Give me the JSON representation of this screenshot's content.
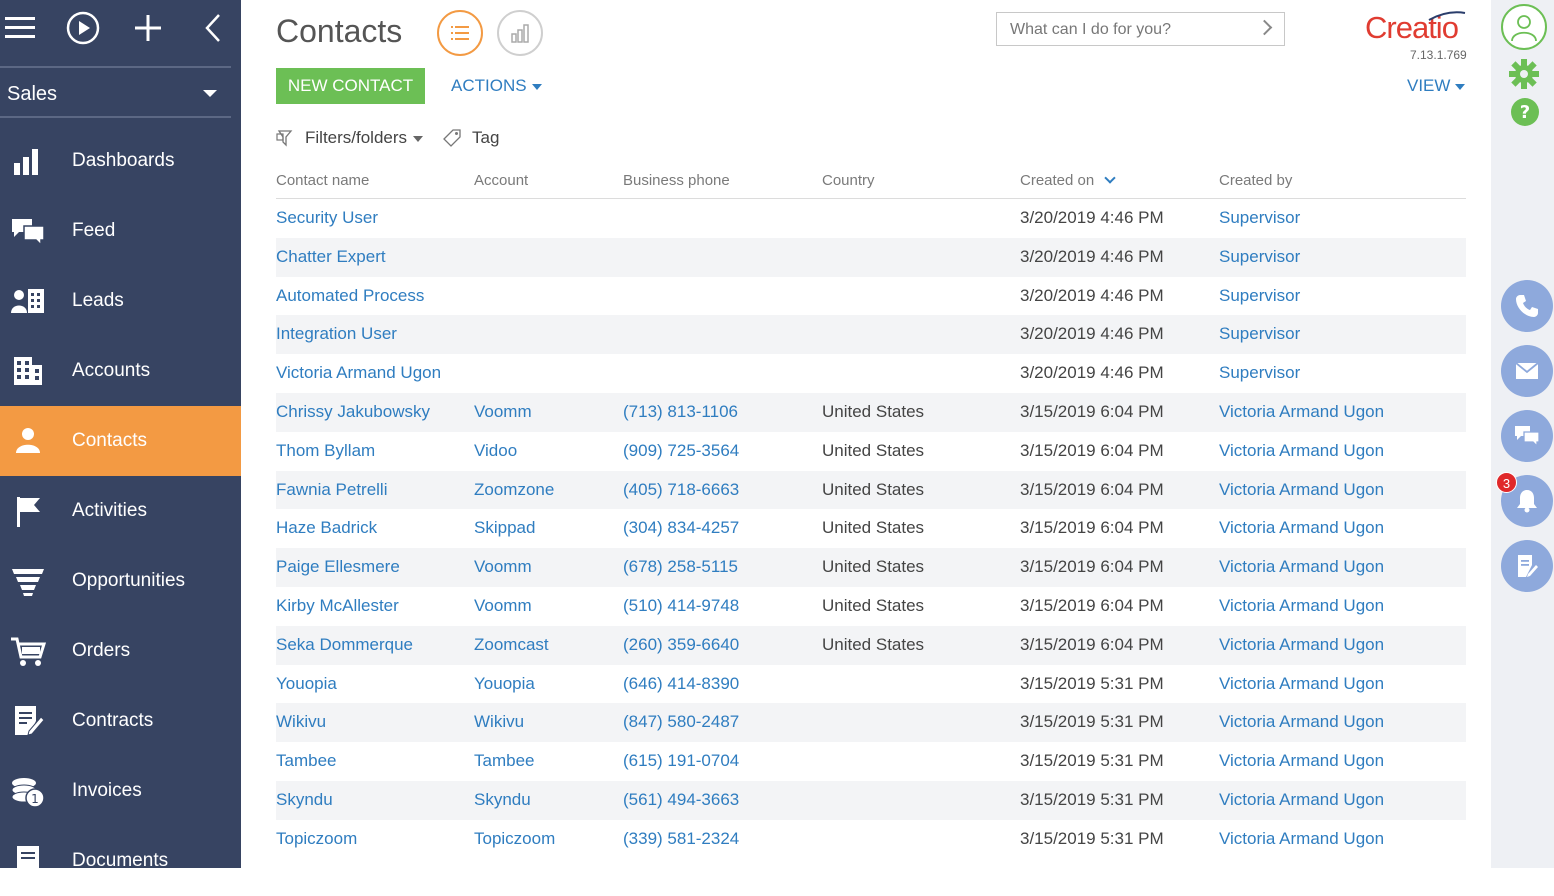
{
  "sidebar": {
    "workspace": "Sales",
    "items": [
      {
        "label": "Dashboards",
        "icon": "dashboards-icon"
      },
      {
        "label": "Feed",
        "icon": "feed-icon"
      },
      {
        "label": "Leads",
        "icon": "leads-icon"
      },
      {
        "label": "Accounts",
        "icon": "accounts-icon"
      },
      {
        "label": "Contacts",
        "icon": "contacts-icon",
        "active": true
      },
      {
        "label": "Activities",
        "icon": "activities-icon"
      },
      {
        "label": "Opportunities",
        "icon": "opportunities-icon"
      },
      {
        "label": "Orders",
        "icon": "orders-icon"
      },
      {
        "label": "Contracts",
        "icon": "contracts-icon"
      },
      {
        "label": "Invoices",
        "icon": "invoices-icon"
      },
      {
        "label": "Documents",
        "icon": "documents-icon"
      }
    ]
  },
  "header": {
    "title": "Contacts",
    "command_placeholder": "What can I do for you?",
    "logo": "Creatio",
    "version": "7.13.1.769",
    "new_contact": "NEW CONTACT",
    "actions": "ACTIONS",
    "view": "VIEW",
    "filters": "Filters/folders",
    "tag": "Tag"
  },
  "grid": {
    "columns": [
      "Contact name",
      "Account",
      "Business phone",
      "Country",
      "Created on",
      "Created by"
    ],
    "rows": [
      [
        "Security User",
        "",
        "",
        "",
        "3/20/2019 4:46 PM",
        "Supervisor"
      ],
      [
        "Chatter Expert",
        "",
        "",
        "",
        "3/20/2019 4:46 PM",
        "Supervisor"
      ],
      [
        "Automated Process",
        "",
        "",
        "",
        "3/20/2019 4:46 PM",
        "Supervisor"
      ],
      [
        "Integration User",
        "",
        "",
        "",
        "3/20/2019 4:46 PM",
        "Supervisor"
      ],
      [
        "Victoria Armand Ugon",
        "",
        "",
        "",
        "3/20/2019 4:46 PM",
        "Supervisor"
      ],
      [
        "Chrissy Jakubowsky",
        "Voomm",
        "(713) 813-1106",
        "United States",
        "3/15/2019 6:04 PM",
        "Victoria Armand Ugon"
      ],
      [
        "Thom Byllam",
        "Vidoo",
        "(909) 725-3564",
        "United States",
        "3/15/2019 6:04 PM",
        "Victoria Armand Ugon"
      ],
      [
        "Fawnia Petrelli",
        "Zoomzone",
        "(405) 718-6663",
        "United States",
        "3/15/2019 6:04 PM",
        "Victoria Armand Ugon"
      ],
      [
        "Haze Badrick",
        "Skippad",
        "(304) 834-4257",
        "United States",
        "3/15/2019 6:04 PM",
        "Victoria Armand Ugon"
      ],
      [
        "Paige Ellesmere",
        "Voomm",
        "(678) 258-5115",
        "United States",
        "3/15/2019 6:04 PM",
        "Victoria Armand Ugon"
      ],
      [
        "Kirby McAllester",
        "Voomm",
        "(510) 414-9748",
        "United States",
        "3/15/2019 6:04 PM",
        "Victoria Armand Ugon"
      ],
      [
        "Seka Dommerque",
        "Zoomcast",
        "(260) 359-6640",
        "United States",
        "3/15/2019 6:04 PM",
        "Victoria Armand Ugon"
      ],
      [
        "Youopia",
        "Youopia",
        "(646) 414-8390",
        "",
        "3/15/2019 5:31 PM",
        "Victoria Armand Ugon"
      ],
      [
        "Wikivu",
        "Wikivu",
        "(847) 580-2487",
        "",
        "3/15/2019 5:31 PM",
        "Victoria Armand Ugon"
      ],
      [
        "Tambee",
        "Tambee",
        "(615) 191-0704",
        "",
        "3/15/2019 5:31 PM",
        "Victoria Armand Ugon"
      ],
      [
        "Skyndu",
        "Skyndu",
        "(561) 494-3663",
        "",
        "3/15/2019 5:31 PM",
        "Victoria Armand Ugon"
      ],
      [
        "Topiczoom",
        "Topiczoom",
        "(339) 581-2324",
        "",
        "3/15/2019 5:31 PM",
        "Victoria Armand Ugon"
      ]
    ]
  },
  "right_panel": {
    "notification_count": "3"
  },
  "colors": {
    "sidebar_bg": "#374462",
    "active_orange": "#f39a43",
    "link_blue": "#2f7dc0",
    "new_button_green": "#6cbf55",
    "logo_red": "#e03c31",
    "communication_button": "#8ea9dc"
  }
}
